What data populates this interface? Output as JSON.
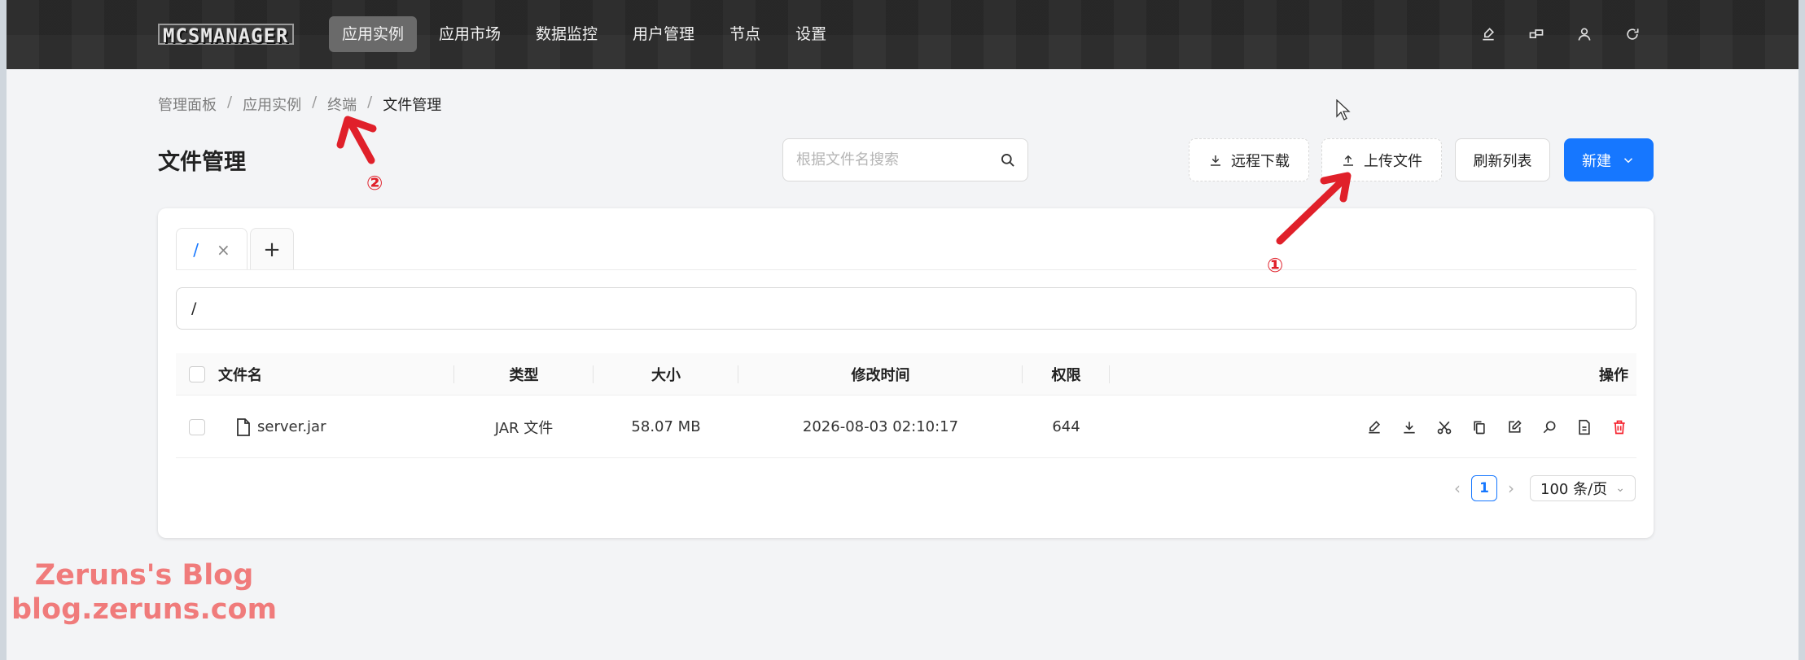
{
  "app": {
    "logo_text": "MCSMANAGER",
    "nav": [
      {
        "label": "应用实例",
        "active": true
      },
      {
        "label": "应用市场",
        "active": false
      },
      {
        "label": "数据监控",
        "active": false
      },
      {
        "label": "用户管理",
        "active": false
      },
      {
        "label": "节点",
        "active": false
      },
      {
        "label": "设置",
        "active": false
      }
    ],
    "nav_icons": [
      "theme-brush-icon",
      "layout-icon",
      "user-icon",
      "logout-icon"
    ]
  },
  "breadcrumb": {
    "items": [
      "管理面板",
      "应用实例",
      "终端",
      "文件管理"
    ],
    "separator": "/"
  },
  "page": {
    "title": "文件管理"
  },
  "search": {
    "placeholder": "根据文件名搜索",
    "value": ""
  },
  "toolbar": {
    "remote_download": "远程下载",
    "upload_file": "上传文件",
    "refresh_list": "刷新列表",
    "new": "新建"
  },
  "tabs": {
    "items": [
      {
        "label": "/",
        "active": true
      }
    ],
    "close_glyph": "×",
    "add_glyph": "+"
  },
  "path": {
    "value": "/"
  },
  "table": {
    "columns": {
      "name": "文件名",
      "type": "类型",
      "size": "大小",
      "modified": "修改时间",
      "permission": "权限",
      "actions": "操作"
    },
    "rows": [
      {
        "name": "server.jar",
        "type": "JAR 文件",
        "size": "58.07 MB",
        "modified": "2026-08-03 02:10:17",
        "permission": "644"
      }
    ],
    "row_actions": [
      "rename-icon",
      "download-icon",
      "cut-icon",
      "copy-icon",
      "edit-icon",
      "search-icon",
      "properties-icon",
      "delete-icon"
    ]
  },
  "pagination": {
    "prev": "‹",
    "current": "1",
    "next": "›",
    "page_size": "100 条/页"
  },
  "annotations": {
    "label_1": "①",
    "label_2": "②",
    "arrow_color": "#e0202a"
  },
  "watermark": {
    "line1": "Zeruns's Blog",
    "line2": "blog.zeruns.com"
  },
  "colors": {
    "primary": "#1677ff",
    "danger": "#f5222d",
    "topbar": "#2b2b2b"
  }
}
